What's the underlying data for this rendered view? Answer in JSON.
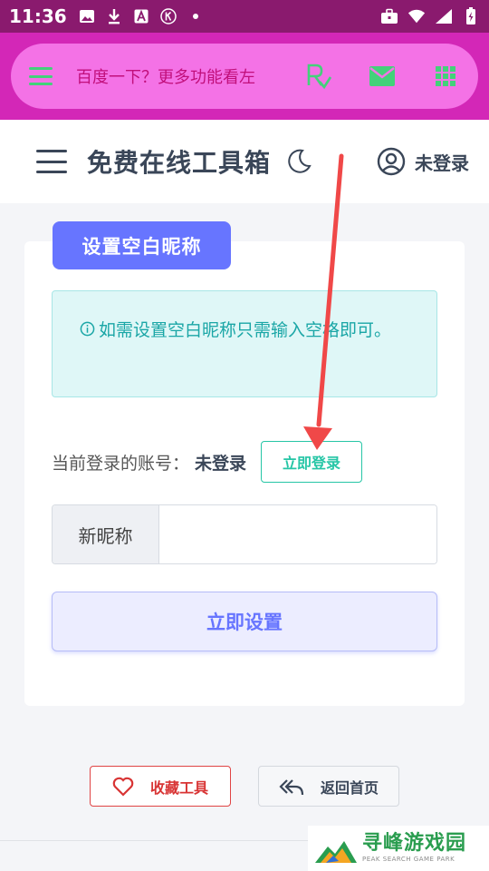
{
  "status_bar": {
    "time": "11:36",
    "left_icons": [
      "image-icon",
      "download-icon",
      "font-a-icon",
      "k-circle-icon",
      "dot-icon"
    ],
    "right_icons": [
      "briefcase-icon",
      "wifi-icon",
      "signal-icon",
      "battery-charging-icon"
    ]
  },
  "browser_bar": {
    "search_text": "百度一下？更多功能看左",
    "icons": [
      "menu-icon",
      "rx-icon",
      "mail-icon",
      "grid-icon"
    ]
  },
  "header": {
    "title": "免费在线工具箱",
    "user_label": "未登录",
    "icons": [
      "hamburger-icon",
      "moon-icon",
      "user-circle-icon"
    ]
  },
  "card": {
    "title": "设置空白昵称",
    "info_text": "如需设置空白昵称只需输入空格即可。",
    "account_label": "当前登录的账号：",
    "account_value": "未登录",
    "login_button": "立即登录",
    "input_addon": "新昵称",
    "input_value": "",
    "input_placeholder": "",
    "submit_button": "立即设置"
  },
  "footer": {
    "favorite_button": "收藏工具",
    "home_button": "返回首页"
  },
  "watermark": {
    "main": "寻峰游戏园",
    "sub": "PEAK SEARCH GAME PARK"
  },
  "colors": {
    "status_bar": "#8a1a6e",
    "browser_bar": "#d327b7",
    "pill": "#f472e6",
    "accent": "#6775ff",
    "teal": "#26c6a6",
    "danger": "#e04444",
    "annotation": "#f04848"
  }
}
